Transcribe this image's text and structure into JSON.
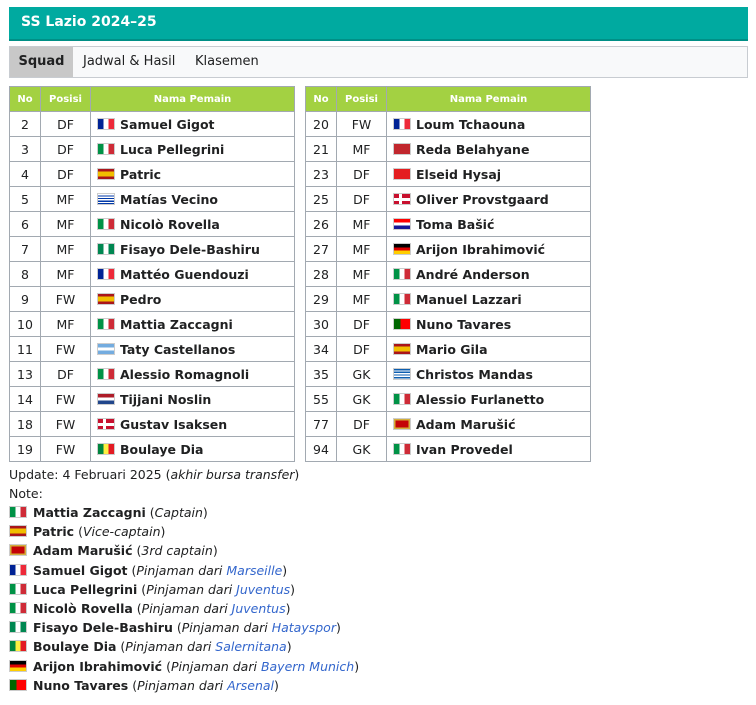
{
  "title": "SS Lazio 2024–25",
  "tabs": [
    "Squad",
    "Jadwal & Hasil",
    "Klasemen"
  ],
  "table_headers": {
    "no": "No",
    "pos": "Posisi",
    "name": "Nama Pemain"
  },
  "left_players": [
    {
      "no": "2",
      "pos": "DF",
      "flag": "fr",
      "name": "Samuel Gigot"
    },
    {
      "no": "3",
      "pos": "DF",
      "flag": "it",
      "name": "Luca Pellegrini"
    },
    {
      "no": "4",
      "pos": "DF",
      "flag": "es",
      "name": "Patric"
    },
    {
      "no": "5",
      "pos": "MF",
      "flag": "uy",
      "name": "Matías Vecino"
    },
    {
      "no": "6",
      "pos": "MF",
      "flag": "it",
      "name": "Nicolò Rovella"
    },
    {
      "no": "7",
      "pos": "MF",
      "flag": "ng",
      "name": "Fisayo Dele-Bashiru"
    },
    {
      "no": "8",
      "pos": "MF",
      "flag": "fr",
      "name": "Mattéo Guendouzi"
    },
    {
      "no": "9",
      "pos": "FW",
      "flag": "es",
      "name": "Pedro"
    },
    {
      "no": "10",
      "pos": "MF",
      "flag": "it",
      "name": "Mattia Zaccagni"
    },
    {
      "no": "11",
      "pos": "FW",
      "flag": "ar",
      "name": "Taty Castellanos"
    },
    {
      "no": "13",
      "pos": "DF",
      "flag": "it",
      "name": "Alessio Romagnoli"
    },
    {
      "no": "14",
      "pos": "FW",
      "flag": "nl",
      "name": "Tijjani Noslin"
    },
    {
      "no": "18",
      "pos": "FW",
      "flag": "dk",
      "name": "Gustav Isaksen"
    },
    {
      "no": "19",
      "pos": "FW",
      "flag": "sn",
      "name": "Boulaye Dia"
    }
  ],
  "right_players": [
    {
      "no": "20",
      "pos": "FW",
      "flag": "fr",
      "name": "Loum Tchaouna"
    },
    {
      "no": "21",
      "pos": "MF",
      "flag": "ma",
      "name": "Reda Belahyane"
    },
    {
      "no": "23",
      "pos": "DF",
      "flag": "al",
      "name": "Elseid Hysaj"
    },
    {
      "no": "25",
      "pos": "DF",
      "flag": "dk",
      "name": "Oliver Provstgaard"
    },
    {
      "no": "26",
      "pos": "MF",
      "flag": "hr",
      "name": "Toma Bašić"
    },
    {
      "no": "27",
      "pos": "MF",
      "flag": "de",
      "name": "Arijon Ibrahimović"
    },
    {
      "no": "28",
      "pos": "MF",
      "flag": "it",
      "name": "André Anderson"
    },
    {
      "no": "29",
      "pos": "MF",
      "flag": "it",
      "name": "Manuel Lazzari"
    },
    {
      "no": "30",
      "pos": "DF",
      "flag": "pt",
      "name": "Nuno Tavares"
    },
    {
      "no": "34",
      "pos": "DF",
      "flag": "es",
      "name": "Mario Gila"
    },
    {
      "no": "35",
      "pos": "GK",
      "flag": "gr",
      "name": "Christos Mandas"
    },
    {
      "no": "55",
      "pos": "GK",
      "flag": "it",
      "name": "Alessio Furlanetto"
    },
    {
      "no": "77",
      "pos": "DF",
      "flag": "me",
      "name": "Adam Marušić"
    },
    {
      "no": "94",
      "pos": "GK",
      "flag": "it",
      "name": "Ivan Provedel"
    }
  ],
  "update": {
    "text": "Update: 4 Februari 2025 (",
    "italic": "akhir bursa transfer",
    "close": ")"
  },
  "note_label": "Note:",
  "notes": [
    {
      "flag": "it",
      "name": "Mattia Zaccagni",
      "prefix": "Captain",
      "club": ""
    },
    {
      "flag": "es",
      "name": "Patric",
      "prefix": "Vice-captain",
      "club": ""
    },
    {
      "flag": "me",
      "name": "Adam Marušić",
      "prefix": "3rd captain",
      "club": ""
    },
    {
      "flag": "fr",
      "name": "Samuel Gigot",
      "prefix": "Pinjaman dari ",
      "club": "Marseille"
    },
    {
      "flag": "it",
      "name": "Luca Pellegrini",
      "prefix": "Pinjaman dari ",
      "club": "Juventus"
    },
    {
      "flag": "it",
      "name": "Nicolò Rovella",
      "prefix": "Pinjaman dari ",
      "club": "Juventus"
    },
    {
      "flag": "ng",
      "name": "Fisayo Dele-Bashiru",
      "prefix": "Pinjaman dari ",
      "club": "Hatayspor"
    },
    {
      "flag": "sn",
      "name": "Boulaye Dia",
      "prefix": "Pinjaman dari ",
      "club": "Salernitana"
    },
    {
      "flag": "de",
      "name": "Arijon Ibrahimović",
      "prefix": "Pinjaman dari ",
      "club": "Bayern Munich"
    },
    {
      "flag": "pt",
      "name": "Nuno Tavares",
      "prefix": "Pinjaman dari ",
      "club": "Arsenal"
    }
  ]
}
